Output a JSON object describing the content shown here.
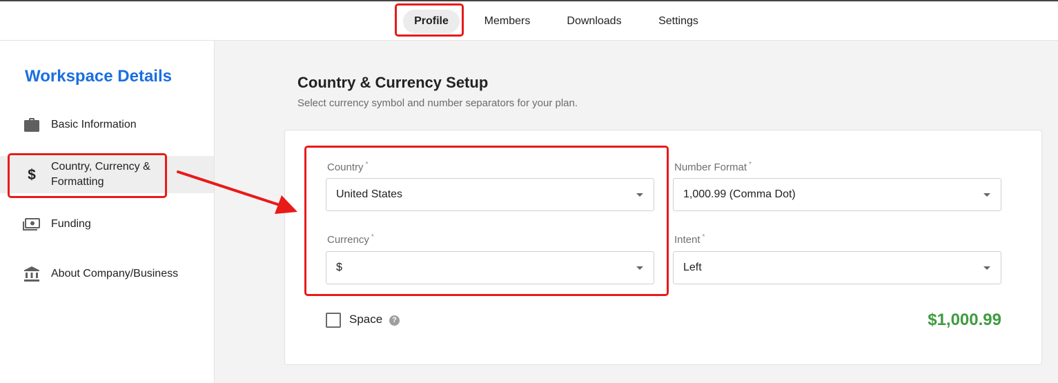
{
  "tabs": [
    {
      "label": "Profile",
      "active": true
    },
    {
      "label": "Members",
      "active": false
    },
    {
      "label": "Downloads",
      "active": false
    },
    {
      "label": "Settings",
      "active": false
    }
  ],
  "sidebar": {
    "title": "Workspace Details",
    "items": [
      {
        "label": "Basic Information",
        "icon": "briefcase-icon",
        "active": false
      },
      {
        "label": "Country, Currency & Formatting",
        "icon": "dollar-icon",
        "active": true
      },
      {
        "label": "Funding",
        "icon": "money-icon",
        "active": false
      },
      {
        "label": "About Company/Business",
        "icon": "bank-icon",
        "active": false
      }
    ]
  },
  "main": {
    "title": "Country & Currency Setup",
    "subtitle": "Select currency symbol and number separators for your plan.",
    "fields": {
      "country": {
        "label": "Country",
        "required_mark": "*",
        "value": "United States"
      },
      "currency": {
        "label": "Currency",
        "required_mark": "*",
        "value": "$"
      },
      "number_format": {
        "label": "Number Format",
        "required_mark": "*",
        "value": "1,000.99 (Comma Dot)"
      },
      "intent": {
        "label": "Intent",
        "required_mark": "*",
        "value": "Left"
      }
    },
    "space_checkbox": {
      "label": "Space",
      "checked": false,
      "help_icon": "?"
    },
    "preview_amount": "$1,000.99"
  },
  "colors": {
    "accent_blue": "#1a6fe0",
    "preview_green": "#3f9b3f",
    "highlight_red": "#e81a1a"
  }
}
